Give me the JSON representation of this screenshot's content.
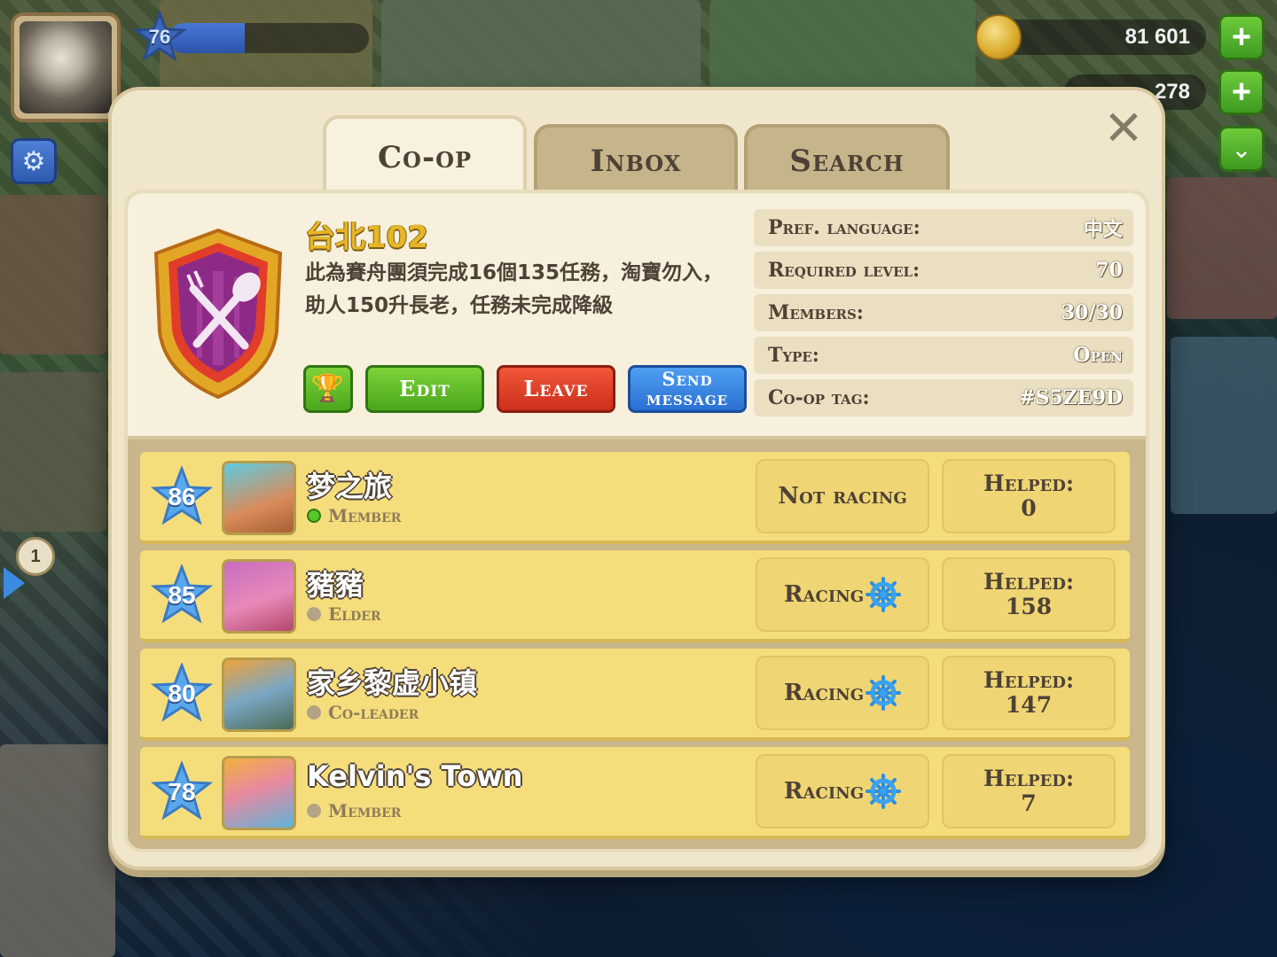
{
  "hud": {
    "level": "76",
    "xp_fraction": 0.38,
    "coins": "81 601",
    "cash": "278",
    "side_badge": "1"
  },
  "tabs": [
    {
      "label": "Co-op",
      "active": true
    },
    {
      "label": "Inbox",
      "active": false
    },
    {
      "label": "Search",
      "active": false
    }
  ],
  "coop": {
    "name": "台北102",
    "description": "此為賽舟團須完成16個135任務，淘寶勿入，助人150升長老，任務未完成降級",
    "buttons": {
      "edit": "Edit",
      "leave": "Leave",
      "send_message": "Send message"
    },
    "info": [
      {
        "label": "Pref. language:",
        "value": "中文"
      },
      {
        "label": "Required level:",
        "value": "70"
      },
      {
        "label": "Members:",
        "value": "30/30"
      },
      {
        "label": "Type:",
        "value": "Open"
      },
      {
        "label": "Co-op tag:",
        "value": "#S5ZE9D"
      }
    ]
  },
  "members": [
    {
      "level": "86",
      "name": "梦之旅",
      "role": "Member",
      "online": true,
      "race": "Not racing",
      "helped_label": "Helped:",
      "helped": "0",
      "avatar": "rabbit-avatar",
      "color": "#d98b5a"
    },
    {
      "level": "85",
      "name": "豬豬",
      "role": "Elder",
      "online": false,
      "race": "Racing",
      "helped_label": "Helped:",
      "helped": "158",
      "avatar": "pig-cake-avatar",
      "color": "#e789b8"
    },
    {
      "level": "80",
      "name": "家乡黎虚小镇",
      "role": "Co-leader",
      "online": false,
      "race": "Racing",
      "helped_label": "Helped:",
      "helped": "147",
      "avatar": "cow-avatar",
      "color": "#7aa6c4"
    },
    {
      "level": "78",
      "name": "Kelvin's Town",
      "role": "Member",
      "online": false,
      "race": "Racing",
      "helped_label": "Helped:",
      "helped": "7",
      "avatar": "party-pig-avatar",
      "color": "#5fb3d6"
    }
  ],
  "colors": {
    "panel": "#efe6cc",
    "member_row": "#f6dd7c",
    "edit": "#4aa71b",
    "leave": "#cc2f1a",
    "send": "#2a70d3"
  }
}
